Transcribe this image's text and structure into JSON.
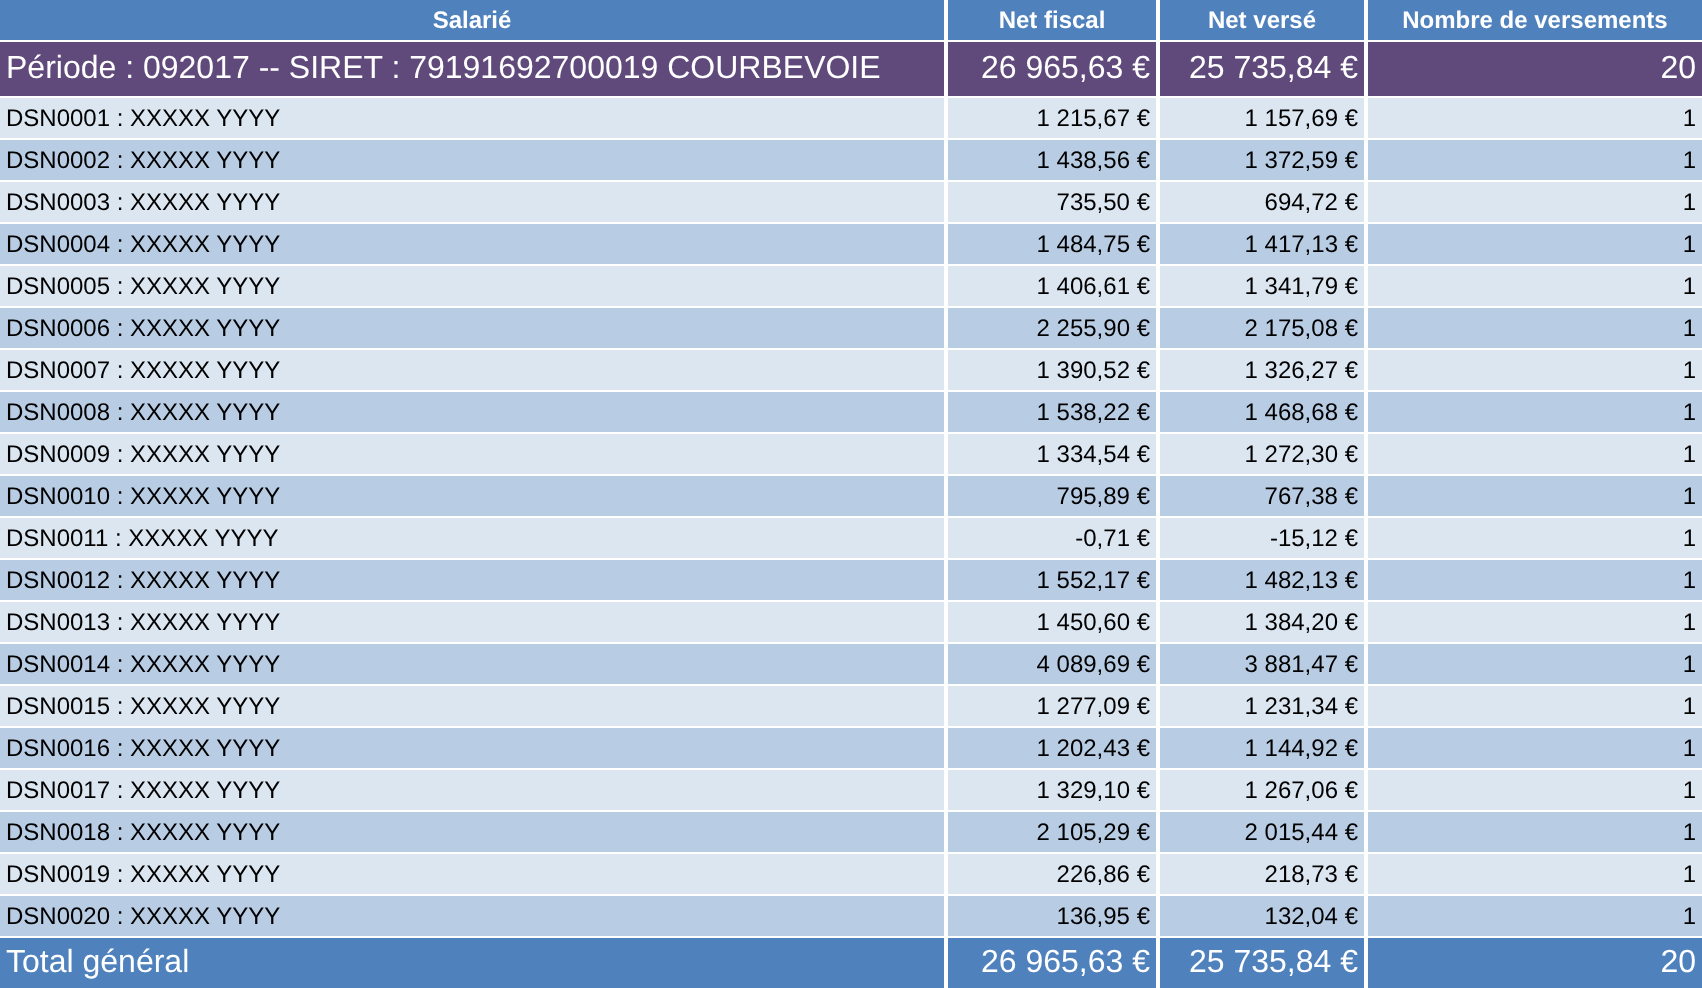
{
  "table": {
    "columns": [
      "Salarié",
      "Net fiscal",
      "Net versé",
      "Nombre de versements"
    ],
    "group": {
      "label": "Période : 092017 --  SIRET : 79191692700019 COURBEVOIE",
      "net_fiscal": "26 965,63 €",
      "net_verse": "25 735,84 €",
      "count": "20"
    },
    "rows": [
      {
        "name": "DSN0001 : XXXXX YYYY",
        "net_fiscal": "1 215,67 €",
        "net_verse": "1 157,69 €",
        "count": "1"
      },
      {
        "name": "DSN0002 : XXXXX YYYY",
        "net_fiscal": "1 438,56 €",
        "net_verse": "1 372,59 €",
        "count": "1"
      },
      {
        "name": "DSN0003 : XXXXX YYYY",
        "net_fiscal": "735,50 €",
        "net_verse": "694,72 €",
        "count": "1"
      },
      {
        "name": "DSN0004 : XXXXX YYYY",
        "net_fiscal": "1 484,75 €",
        "net_verse": "1 417,13 €",
        "count": "1"
      },
      {
        "name": "DSN0005 : XXXXX YYYY",
        "net_fiscal": "1 406,61 €",
        "net_verse": "1 341,79 €",
        "count": "1"
      },
      {
        "name": "DSN0006 : XXXXX YYYY",
        "net_fiscal": "2 255,90 €",
        "net_verse": "2 175,08 €",
        "count": "1"
      },
      {
        "name": "DSN0007 : XXXXX YYYY",
        "net_fiscal": "1 390,52 €",
        "net_verse": "1 326,27 €",
        "count": "1"
      },
      {
        "name": "DSN0008 : XXXXX YYYY",
        "net_fiscal": "1 538,22 €",
        "net_verse": "1 468,68 €",
        "count": "1"
      },
      {
        "name": "DSN0009 : XXXXX YYYY",
        "net_fiscal": "1 334,54 €",
        "net_verse": "1 272,30 €",
        "count": "1"
      },
      {
        "name": "DSN0010 : XXXXX YYYY",
        "net_fiscal": "795,89 €",
        "net_verse": "767,38 €",
        "count": "1"
      },
      {
        "name": "DSN0011 : XXXXX YYYY",
        "net_fiscal": "-0,71 €",
        "net_verse": "-15,12 €",
        "count": "1"
      },
      {
        "name": "DSN0012 : XXXXX YYYY",
        "net_fiscal": "1 552,17 €",
        "net_verse": "1 482,13 €",
        "count": "1"
      },
      {
        "name": "DSN0013 : XXXXX YYYY",
        "net_fiscal": "1 450,60 €",
        "net_verse": "1 384,20 €",
        "count": "1"
      },
      {
        "name": "DSN0014 : XXXXX YYYY",
        "net_fiscal": "4 089,69 €",
        "net_verse": "3 881,47 €",
        "count": "1"
      },
      {
        "name": "DSN0015 : XXXXX YYYY",
        "net_fiscal": "1 277,09 €",
        "net_verse": "1 231,34 €",
        "count": "1"
      },
      {
        "name": "DSN0016 : XXXXX YYYY",
        "net_fiscal": "1 202,43 €",
        "net_verse": "1 144,92 €",
        "count": "1"
      },
      {
        "name": "DSN0017 : XXXXX YYYY",
        "net_fiscal": "1 329,10 €",
        "net_verse": "1 267,06 €",
        "count": "1"
      },
      {
        "name": "DSN0018 : XXXXX YYYY",
        "net_fiscal": "2 105,29 €",
        "net_verse": "2 015,44 €",
        "count": "1"
      },
      {
        "name": "DSN0019 : XXXXX YYYY",
        "net_fiscal": "226,86 €",
        "net_verse": "218,73 €",
        "count": "1"
      },
      {
        "name": "DSN0020 : XXXXX YYYY",
        "net_fiscal": "136,95 €",
        "net_verse": "132,04 €",
        "count": "1"
      }
    ],
    "total": {
      "label": "Total général",
      "net_fiscal": "26 965,63 €",
      "net_verse": "25 735,84 €",
      "count": "20"
    }
  }
}
